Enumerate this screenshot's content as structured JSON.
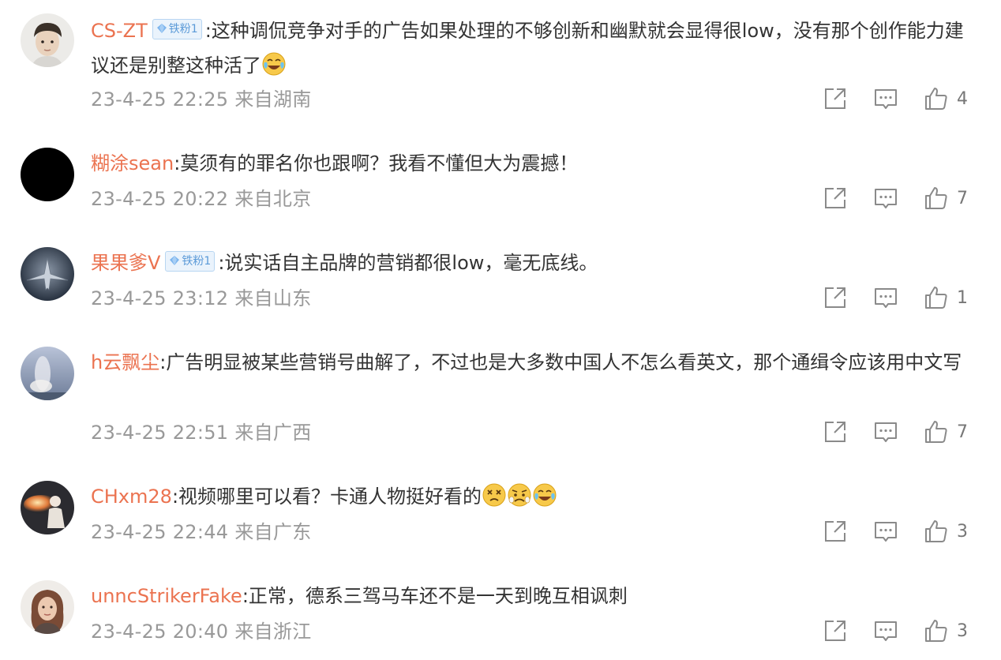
{
  "comments": [
    {
      "username": "CS-ZT",
      "badge": "铁粉1",
      "text": ":这种调侃竞争对手的广告如果处理的不够创新和幽默就会显得很low，没有那个创作能力建议还是别整这种活了",
      "emojis": [
        "laugh-cry"
      ],
      "time": "23-4-25 22:25",
      "location": "来自湖南",
      "likes": "4"
    },
    {
      "username": "糊涂sean",
      "badge": null,
      "text": ":莫须有的罪名你也跟啊？我看不懂但大为震撼！",
      "emojis": [],
      "time": "23-4-25 20:22",
      "location": "来自北京",
      "likes": "7"
    },
    {
      "username": "果果爹V",
      "badge": "铁粉1",
      "text": ":说实话自主品牌的营销都很low，毫无底线。",
      "emojis": [],
      "time": "23-4-25 23:12",
      "location": "来自山东",
      "likes": "1"
    },
    {
      "username": "h云飘尘",
      "badge": null,
      "text": ":广告明显被某些营销号曲解了，不过也是大多数中国人不怎么看英文，那个通缉令应该用中文写",
      "emojis": [],
      "time": "23-4-25 22:51",
      "location": "来自广西",
      "likes": "7"
    },
    {
      "username": "CHxm28",
      "badge": null,
      "text": ":视频哪里可以看？卡通人物挺好看的",
      "emojis": [
        "dizzy",
        "worried",
        "laugh-cry"
      ],
      "time": "23-4-25 22:44",
      "location": "来自广东",
      "likes": "3"
    },
    {
      "username": "unncStrikerFake",
      "badge": null,
      "text": ":正常，德系三驾马车还不是一天到晚互相讽刺",
      "emojis": [],
      "time": "23-4-25 20:40",
      "location": "来自浙江",
      "likes": "3"
    }
  ],
  "icons": {
    "share": "share-icon",
    "comment": "comment-icon",
    "like": "thumbs-up-icon"
  },
  "colors": {
    "username": "#eb7350",
    "meta": "#999999",
    "text": "#333333",
    "badge_bg": "#eaf3fc",
    "badge_text": "#5b9ad8"
  }
}
